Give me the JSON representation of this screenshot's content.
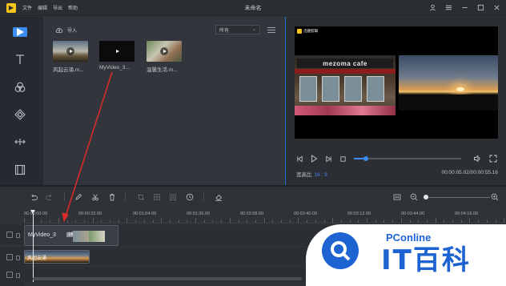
{
  "titlebar": {
    "menu": [
      "文件",
      "编辑",
      "导出",
      "帮助"
    ],
    "title": "未命名"
  },
  "media": {
    "import_label": "导入",
    "filter": "所有",
    "items": [
      {
        "name": "风起云涌.m..."
      },
      {
        "name": "MyVideo_3..."
      },
      {
        "name": "温馨生活.m..."
      }
    ]
  },
  "preview": {
    "watermark": "迅捷剪辑",
    "sign_text": "mezoma cafe",
    "aspect_label": "宽高比",
    "aspect_value": "16 : 9",
    "time_current": "00:00:05.02",
    "time_total": "00:00:55.16",
    "progress": 0.11
  },
  "ruler": {
    "labels": [
      "00:00:00.00",
      "00:00:32.00",
      "00:01:04.00",
      "00:01:36.00",
      "00:02:08.00",
      "00:02:40.00",
      "00:03:12.00",
      "00:03:44.00",
      "00:04:16.00"
    ]
  },
  "timeline": {
    "video_clip_label": "MyVideo_3",
    "video_clip_tag": "16",
    "image_clip_label": "风起云涌"
  },
  "badge": {
    "brand": "PConline",
    "mark": "IT百科"
  },
  "colors": {
    "accent": "#3d8cf2",
    "arrow": "#d92b2b",
    "badge_blue": "#1d63d1"
  }
}
